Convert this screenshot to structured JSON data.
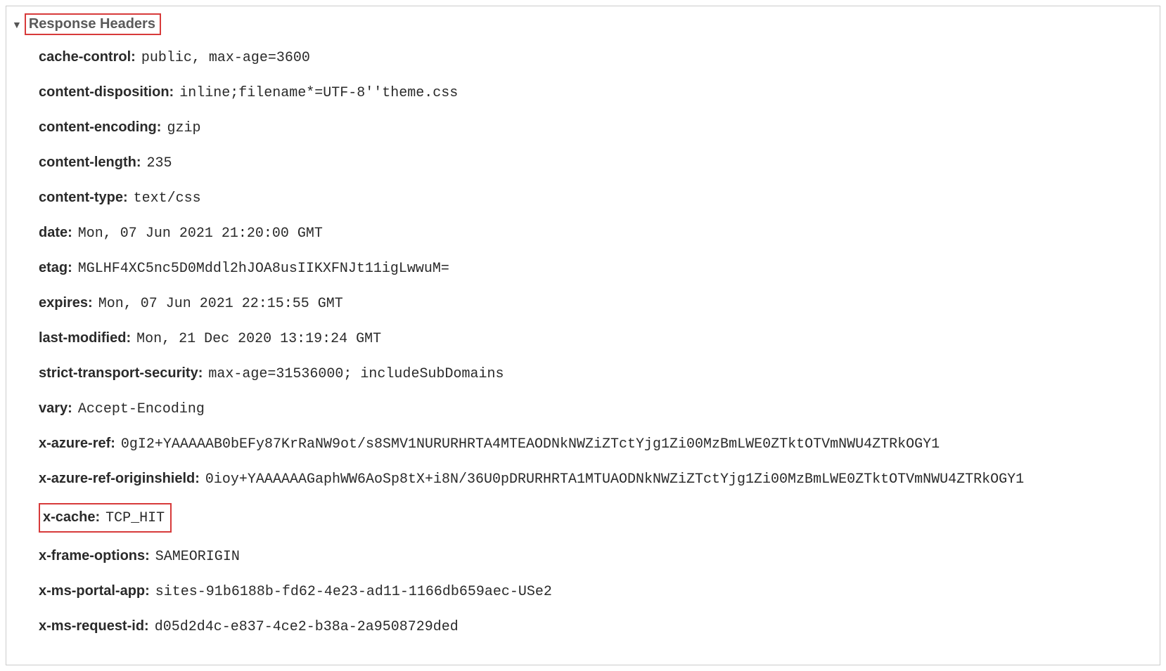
{
  "section_title": "Response Headers",
  "headers": [
    {
      "name": "cache-control:",
      "value": "public, max-age=3600"
    },
    {
      "name": "content-disposition:",
      "value": "inline;filename*=UTF-8''theme.css"
    },
    {
      "name": "content-encoding:",
      "value": "gzip"
    },
    {
      "name": "content-length:",
      "value": "235"
    },
    {
      "name": "content-type:",
      "value": "text/css"
    },
    {
      "name": "date:",
      "value": "Mon, 07 Jun 2021 21:20:00 GMT"
    },
    {
      "name": "etag:",
      "value": "MGLHF4XC5nc5D0Mddl2hJOA8usIIKXFNJt11igLwwuM="
    },
    {
      "name": "expires:",
      "value": "Mon, 07 Jun 2021 22:15:55 GMT"
    },
    {
      "name": "last-modified:",
      "value": "Mon, 21 Dec 2020 13:19:24 GMT"
    },
    {
      "name": "strict-transport-security:",
      "value": "max-age=31536000; includeSubDomains"
    },
    {
      "name": "vary:",
      "value": "Accept-Encoding"
    },
    {
      "name": "x-azure-ref:",
      "value": "0gI2+YAAAAAB0bEFy87KrRaNW9ot/s8SMV1NURURHRTA4MTEAODNkNWZiZTctYjg1Zi00MzBmLWE0ZTktOTVmNWU4ZTRkOGY1"
    },
    {
      "name": "x-azure-ref-originshield:",
      "value": "0ioy+YAAAAAAGaphWW6AoSp8tX+i8N/36U0pDRURHRTA1MTUAODNkNWZiZTctYjg1Zi00MzBmLWE0ZTktOTVmNWU4ZTRkOGY1"
    },
    {
      "name": "x-cache:",
      "value": "TCP_HIT"
    },
    {
      "name": "x-frame-options:",
      "value": "SAMEORIGIN"
    },
    {
      "name": "x-ms-portal-app:",
      "value": "sites-91b6188b-fd62-4e23-ad11-1166db659aec-USe2"
    },
    {
      "name": "x-ms-request-id:",
      "value": "d05d2d4c-e837-4ce2-b38a-2a9508729ded"
    }
  ]
}
